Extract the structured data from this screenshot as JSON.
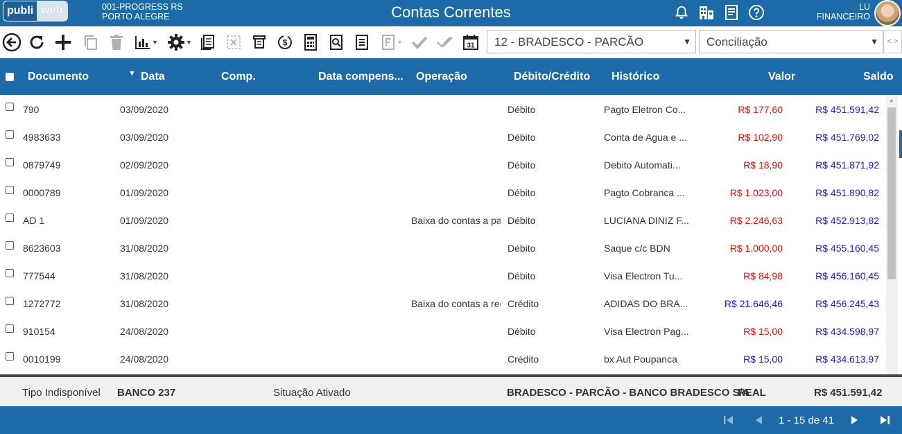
{
  "header": {
    "logo_part1": "publi",
    "logo_part2": "web",
    "company_line1": "001-PROGRESS RS",
    "company_line2": "PORTO ALEGRE",
    "title": "Contas Correntes",
    "user_line1": "LU",
    "user_line2": "FINANCEIRO",
    "icons": [
      "bell-icon",
      "building-icon",
      "document-icon",
      "help-icon"
    ]
  },
  "toolbar": {
    "account_select": "12 - BRADESCO - PARCÃO",
    "mode_select": "Conciliação"
  },
  "table": {
    "columns": [
      "Documento",
      "Data",
      "Comp.",
      "Data compens...",
      "Operação",
      "Débito/Crédito",
      "Histórico",
      "Valor",
      "Saldo"
    ],
    "rows": [
      {
        "documento": "790",
        "data": "03/09/2020",
        "comp": "",
        "data_comp": "",
        "operacao": "",
        "tipo": "Débito",
        "historico": "Pagto Eletron Co...",
        "valor": "R$ 177,60",
        "saldo": "R$ 451.591,42"
      },
      {
        "documento": "4983633",
        "data": "03/09/2020",
        "comp": "",
        "data_comp": "",
        "operacao": "",
        "tipo": "Débito",
        "historico": "Conta de Agua e ...",
        "valor": "R$ 102,90",
        "saldo": "R$ 451.769,02"
      },
      {
        "documento": "0879749",
        "data": "02/09/2020",
        "comp": "",
        "data_comp": "",
        "operacao": "",
        "tipo": "Débito",
        "historico": "Debito Automati...",
        "valor": "R$ 18,90",
        "saldo": "R$ 451.871,92"
      },
      {
        "documento": "0000789",
        "data": "01/09/2020",
        "comp": "",
        "data_comp": "",
        "operacao": "",
        "tipo": "Débito",
        "historico": "Pagto Cobranca ...",
        "valor": "R$ 1.023,00",
        "saldo": "R$ 451.890,82"
      },
      {
        "documento": "AD 1",
        "data": "01/09/2020",
        "comp": "",
        "data_comp": "",
        "operacao": "Baixa do contas a pag",
        "tipo": "Débito",
        "historico": "LUCIANA DINIZ F...",
        "valor": "R$ 2.246,63",
        "saldo": "R$ 452.913,82"
      },
      {
        "documento": "8623603",
        "data": "31/08/2020",
        "comp": "",
        "data_comp": "",
        "operacao": "",
        "tipo": "Débito",
        "historico": "Saque c/c BDN",
        "valor": "R$ 1.000,00",
        "saldo": "R$ 455.160,45"
      },
      {
        "documento": "777544",
        "data": "31/08/2020",
        "comp": "",
        "data_comp": "",
        "operacao": "",
        "tipo": "Débito",
        "historico": "Visa Electron Tu...",
        "valor": "R$ 84,98",
        "saldo": "R$ 456.160,45"
      },
      {
        "documento": "1272772",
        "data": "31/08/2020",
        "comp": "",
        "data_comp": "",
        "operacao": "Baixa do contas a rec",
        "tipo": "Crédito",
        "historico": "ADIDAS DO BRA...",
        "valor": "R$ 21.646,46",
        "saldo": "R$ 456.245,43"
      },
      {
        "documento": "910154",
        "data": "24/08/2020",
        "comp": "",
        "data_comp": "",
        "operacao": "",
        "tipo": "Débito",
        "historico": "Visa Electron Pag...",
        "valor": "R$ 15,00",
        "saldo": "R$ 434.598,97"
      },
      {
        "documento": "0010199",
        "data": "24/08/2020",
        "comp": "",
        "data_comp": "",
        "operacao": "",
        "tipo": "Crédito",
        "historico": "bx Aut Poupanca",
        "valor": "R$ 15,00",
        "saldo": "R$ 434.613,97"
      }
    ]
  },
  "footer": {
    "tipo": "Tipo Indisponível",
    "banco": "BANCO 237",
    "situacao": "Situação Ativado",
    "conta": "BRADESCO - PARCÃO - BANCO BRADESCO S/A",
    "moeda": "REAL",
    "saldo": "R$ 451.591,42"
  },
  "pager": {
    "info": "1 - 15 de 41"
  },
  "colors": {
    "primary": "#1c6aa8",
    "debit": "#e01010",
    "credit": "#1a1ad0"
  }
}
